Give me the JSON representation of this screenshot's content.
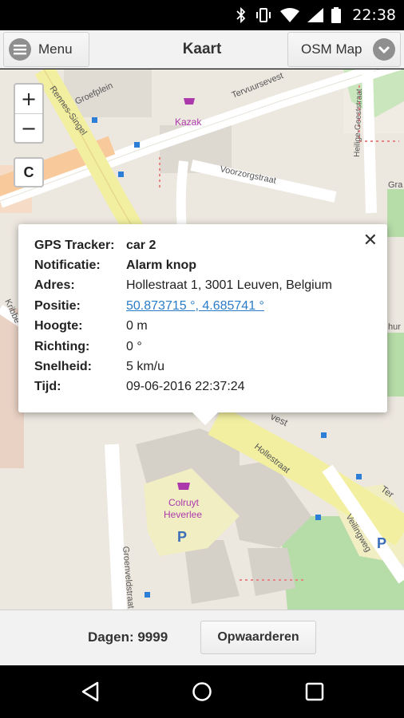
{
  "status_bar": {
    "time": "22:38",
    "icons": [
      "bluetooth-icon",
      "vibrate-icon",
      "wifi-icon",
      "signal-icon",
      "battery-icon"
    ]
  },
  "header": {
    "menu_label": "Menu",
    "menu_icon": "hamburger-icon",
    "title": "Kaart",
    "map_select_label": "OSM Map",
    "map_select_icon": "chevron-down-icon"
  },
  "map": {
    "zoom_in": "+",
    "zoom_out": "−",
    "center_label": "C",
    "labels": {
      "rennes_singel": "Rennes-Singel",
      "groefplein": "Groefplein",
      "kazak": "Kazak",
      "tervuursevest": "Tervuursevest",
      "voorzorgstraat": "Voorzorgstraat",
      "heilige_geeststraat": "Heilige-Geeststraat",
      "hollestraat": "Hollestraat",
      "colruyt": "Colruyt",
      "heverlee": "Heverlee",
      "groenveldstraat": "Groenveldstraat",
      "veilingweg": "Veilingweg",
      "krib": "Kribbe",
      "vest": "vest",
      "ter": "Ter",
      "gra": "Gra",
      "hur": "hur",
      "parking": "P"
    }
  },
  "popup": {
    "close": "✕",
    "rows": [
      {
        "label": "GPS Tracker:",
        "value": "car 2"
      },
      {
        "label": "Notificatie:",
        "value": "Alarm knop"
      },
      {
        "label": "Adres:",
        "value": "Hollestraat 1, 3001 Leuven, Belgium"
      },
      {
        "label": "Positie:",
        "value": "50.873715 °, 4.685741 °"
      },
      {
        "label": "Hoogte:",
        "value": "0 m"
      },
      {
        "label": "Richting:",
        "value": "0 °"
      },
      {
        "label": "Snelheid:",
        "value": "5 km/u"
      },
      {
        "label": "Tijd:",
        "value": "09-06-2016 22:37:24"
      }
    ]
  },
  "bottom": {
    "days": "Dagen: 9999",
    "upgrade": "Opwaarderen"
  },
  "nav": {
    "icons": [
      "back-icon",
      "home-icon",
      "recents-icon"
    ]
  },
  "colors": {
    "link": "#2a7cc7",
    "map_bg": "#ece7df",
    "road_orange": "#f7c99b",
    "road_yellow": "#f2f0a0",
    "park_green": "#b6dca8",
    "shop_purple": "#ac39ac"
  }
}
